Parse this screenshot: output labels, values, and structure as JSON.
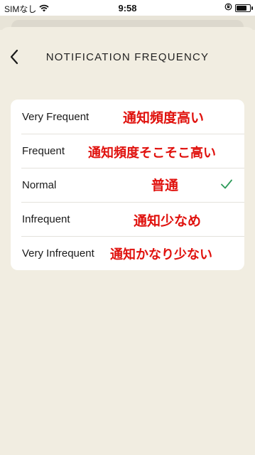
{
  "status_bar": {
    "carrier": "SIMなし",
    "time": "9:58"
  },
  "header": {
    "title": "NOTIFICATION FREQUENCY"
  },
  "options": [
    {
      "label": "Very Frequent",
      "annotation": "通知頻度高い",
      "selected": false
    },
    {
      "label": "Frequent",
      "annotation": "通知頻度そこそこ高い",
      "selected": false
    },
    {
      "label": "Normal",
      "annotation": "普通",
      "selected": true
    },
    {
      "label": "Infrequent",
      "annotation": "通知少なめ",
      "selected": false
    },
    {
      "label": "Very Infrequent",
      "annotation": "通知かなり少ない",
      "selected": false
    }
  ],
  "colors": {
    "background": "#f1ede1",
    "card": "#ffffff",
    "annotation": "#e0110d",
    "check": "#2e9b5a"
  },
  "icons": {
    "back": "chevron-left-icon",
    "selected": "checkmark-icon",
    "wifi": "wifi-icon",
    "battery": "battery-icon",
    "orientation_lock": "orientation-lock-icon"
  }
}
